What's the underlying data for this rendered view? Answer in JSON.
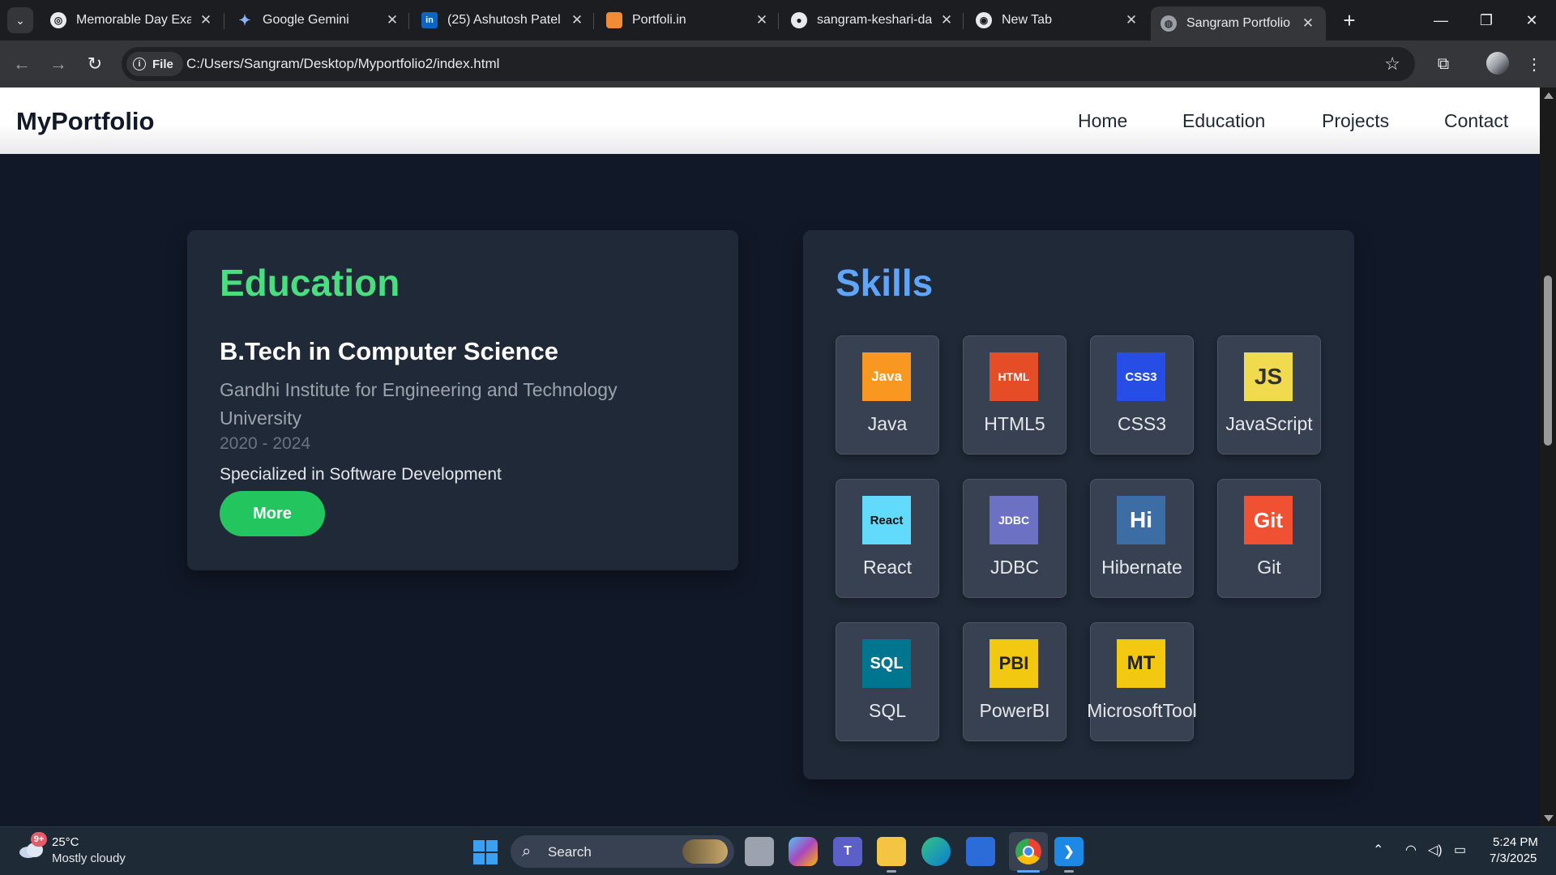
{
  "browser": {
    "tabs": [
      {
        "title": "Memorable Day Exan",
        "icon": "openai-icon"
      },
      {
        "title": "Google Gemini",
        "icon": "gemini-icon"
      },
      {
        "title": "(25) Ashutosh Patel |",
        "icon": "linkedin-icon"
      },
      {
        "title": "Portfoli.in",
        "icon": "portfolio-icon"
      },
      {
        "title": "sangram-keshari-das",
        "icon": "github-icon"
      },
      {
        "title": "New Tab",
        "icon": "chrome-icon"
      },
      {
        "title": "Sangram Portfolio",
        "icon": "globe-icon",
        "active": true
      }
    ],
    "chip_label": "File",
    "url": "C:/Users/Sangram/Desktop/Myportfolio2/index.html"
  },
  "site": {
    "brand": "MyPortfolio",
    "nav": [
      "Home",
      "Education",
      "Projects",
      "Contact"
    ]
  },
  "education": {
    "title": "Education",
    "degree": "B.Tech in Computer Science",
    "institute": "Gandhi Institute for Engineering and Technology University",
    "years": "2020 - 2024",
    "specialization": "Specialized in Software Development",
    "button": "More"
  },
  "skills": {
    "title": "Skills",
    "items": [
      {
        "name": "Java",
        "logo": "Java",
        "color": "#f89820"
      },
      {
        "name": "HTML5",
        "logo": "HTML",
        "color": "#e44d26"
      },
      {
        "name": "CSS3",
        "logo": "CSS3",
        "color": "#264de4"
      },
      {
        "name": "JavaScript",
        "logo": "JS",
        "color": "#f0db4f"
      },
      {
        "name": "React",
        "logo": "React",
        "color": "#61dafb"
      },
      {
        "name": "JDBC",
        "logo": "JDBC",
        "color": "#6c71c4"
      },
      {
        "name": "Hibernate",
        "logo": "Hi",
        "color": "#3c6ea5"
      },
      {
        "name": "Git",
        "logo": "Git",
        "color": "#f05133"
      },
      {
        "name": "SQL",
        "logo": "SQL",
        "color": "#00758f"
      },
      {
        "name": "PowerBI",
        "logo": "PBI",
        "color": "#f2c811"
      },
      {
        "name": "MicrosoftTool",
        "logo": "MT",
        "color": "#f2c811"
      }
    ]
  },
  "taskbar": {
    "badge": "9+",
    "temp": "25°C",
    "condition": "Mostly cloudy",
    "search_label": "Search",
    "time": "5:24 PM",
    "date": "7/3/2025"
  }
}
